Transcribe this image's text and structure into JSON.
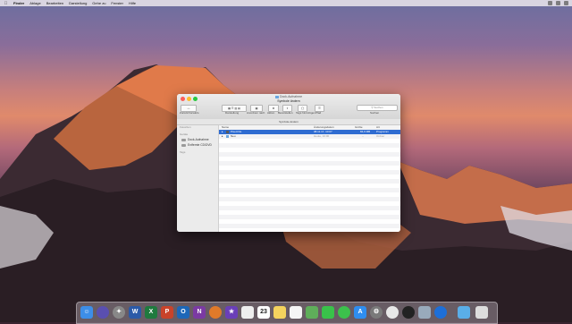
{
  "menubar": {
    "apple_icon": "apple-icon",
    "items": [
      "Finder",
      "Ablage",
      "Bearbeiten",
      "Darstellung",
      "Gehe zu",
      "Fenster",
      "Hilfe"
    ]
  },
  "window": {
    "title": "Dock-Aufnahme",
    "path_label": "Symbole ändern",
    "tab_label": "Symbole ändern",
    "toolbar": {
      "back_forward_label": "Zurück/Vorwärts",
      "view_label": "Darstellung",
      "arrange_label": "Anordnen nach",
      "action_label": "Aktion",
      "share_label": "Bereitstellen",
      "tags_label": "Tags hinzufügen",
      "path_label": "Pfad",
      "search_placeholder": "Suchen",
      "search_label": "Suchen"
    },
    "sidebar": {
      "favorites_header": "Favoriten",
      "devices_header": "Geräte",
      "devices": [
        "Dock-Aufnahme",
        "Entfernte CD/DVD"
      ],
      "tags_header": "Tags"
    },
    "columns": {
      "name": "Name",
      "date": "Änderungsdatum",
      "size": "Größe",
      "kind": "Art"
    },
    "files": [
      {
        "name": "Pixel-File",
        "date": "08.11.17, 10:07",
        "size": "84,6 MB",
        "kind": "Programm",
        "selected": true
      },
      {
        "name": "Neu",
        "date": "Heute, 10:00",
        "size": "--",
        "kind": "Ordner",
        "selected": false
      }
    ]
  },
  "dock": {
    "icons": [
      "finder-icon",
      "siri-icon",
      "launchpad-icon",
      "word-icon",
      "excel-icon",
      "powerpoint-icon",
      "outlook-icon",
      "onenote-icon",
      "firefox-icon",
      "imovie-icon",
      "photos-icon",
      "calendar-icon",
      "notes-icon",
      "reminders-icon",
      "maps-icon",
      "facetime-icon",
      "messages-icon",
      "appstore-icon",
      "settings-icon",
      "itunes-icon",
      "quicktime-icon",
      "preview-icon",
      "teamviewer-icon",
      "folder-icon",
      "trash-icon"
    ]
  }
}
